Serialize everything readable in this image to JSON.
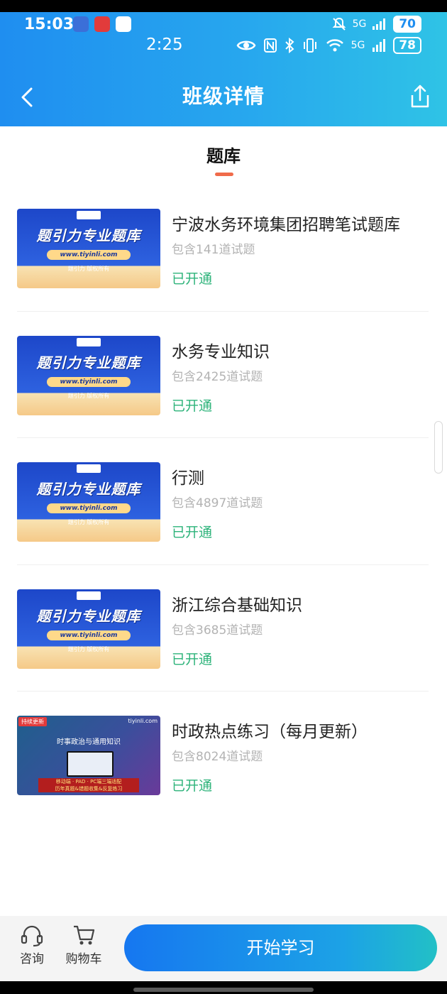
{
  "status_bar": {
    "time_primary": "15:03",
    "time_secondary": "2:25",
    "network_primary": "5G",
    "network_secondary": "5G",
    "battery_primary": "70",
    "battery_secondary": "78"
  },
  "header": {
    "title": "班级详情"
  },
  "tab": {
    "label": "题库"
  },
  "thumbnail": {
    "brand": "题引力专业题库",
    "url": "www.tiyinli.com",
    "copyright": "题引力 版权所有"
  },
  "thumbnail_alt": {
    "tag": "持续更新",
    "site": "tiyinli.com",
    "headline": "时事政治与通用知识",
    "bar_line1": "移动端 · PAD · PC端三端适配",
    "bar_line2": "历年真题&错题收集&反复练习"
  },
  "items": [
    {
      "title": "宁波水务环境集团招聘笔试题库",
      "count": "包含141道试题",
      "status": "已开通"
    },
    {
      "title": "水务专业知识",
      "count": "包含2425道试题",
      "status": "已开通"
    },
    {
      "title": "行测",
      "count": "包含4897道试题",
      "status": "已开通"
    },
    {
      "title": "浙江综合基础知识",
      "count": "包含3685道试题",
      "status": "已开通"
    },
    {
      "title": "时政热点练习（每月更新）",
      "count": "包含8024道试题",
      "status": "已开通"
    }
  ],
  "bottom": {
    "consult_label": "咨询",
    "cart_label": "购物车",
    "start_label": "开始学习"
  },
  "colors": {
    "accent": "#1f8ef0",
    "status_green": "#2db37a",
    "tab_underline": "#f06b4a"
  }
}
